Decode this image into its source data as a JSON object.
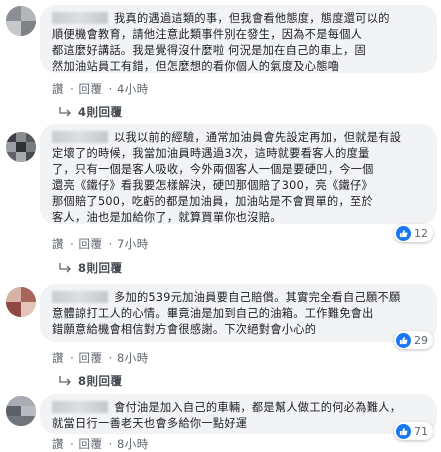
{
  "comments": [
    {
      "text_lines": [
        "我真的遇過這類的事，但我會看他態度，態度還可以的",
        "順便機會教育，請他注意此類事件別在發生，因為不是每個人",
        "都這麼好講話。我是覺得沒什麼啦 何況是加在自己的車上，固",
        "然加油站員工有錯，但怎麼想的看你個人的氣度及心態嚕"
      ],
      "actions": {
        "like": "讚",
        "reply": "回覆",
        "time": "4小時"
      },
      "replies": "4則回覆",
      "reaction_count": ""
    },
    {
      "text_lines": [
        "以我以前的經驗，通常加油員會先設定再加，但就是有設",
        "定壞了的時候，我當加油員時遇過3次，這時就要看客人的度量",
        "了，只有一個是客人吸收，今外兩個客人一個是要硬凹，今一個",
        "還亮《鐵仔》看我要怎樣解決，硬凹那個賠了300，亮《鐵仔》",
        "那個賠了500，吃虧的都是加油員，加油站是不會買單的，至於",
        "客人，油也是加給你了，就算買單你也沒賠。"
      ],
      "actions": {
        "like": "讚",
        "reply": "回覆",
        "time": "7小時"
      },
      "replies": "8則回覆",
      "reaction_count": "12"
    },
    {
      "text_lines": [
        "多加的539元加油員要自己賠償。其實完全看自己願不願",
        "意體諒打工人的心情。畢竟油是加到自己的油箱。工作難免會出",
        "錯願意給機會相信對方會很感謝。下次絕對會小心的"
      ],
      "actions": {
        "like": "讚",
        "reply": "回覆",
        "time": "8小時"
      },
      "replies": "8則回覆",
      "reaction_count": "29"
    },
    {
      "text_lines": [
        "會付油是加入自己的車輛，都是幫人做工的何必為難人，",
        "就當日行一善老天也會多給你一點好運"
      ],
      "actions": {
        "like": "讚",
        "reply": "回覆",
        "time": "8小時"
      },
      "replies": "",
      "reaction_count": "71"
    }
  ],
  "colors": {
    "bubble": "#f2f3f5",
    "meta": "#606770",
    "like_blue": "#1877f2",
    "text": "#1c1e21"
  },
  "icons": {
    "like": "thumbs-up-icon",
    "reply_arrow": "reply-arrow-icon"
  }
}
